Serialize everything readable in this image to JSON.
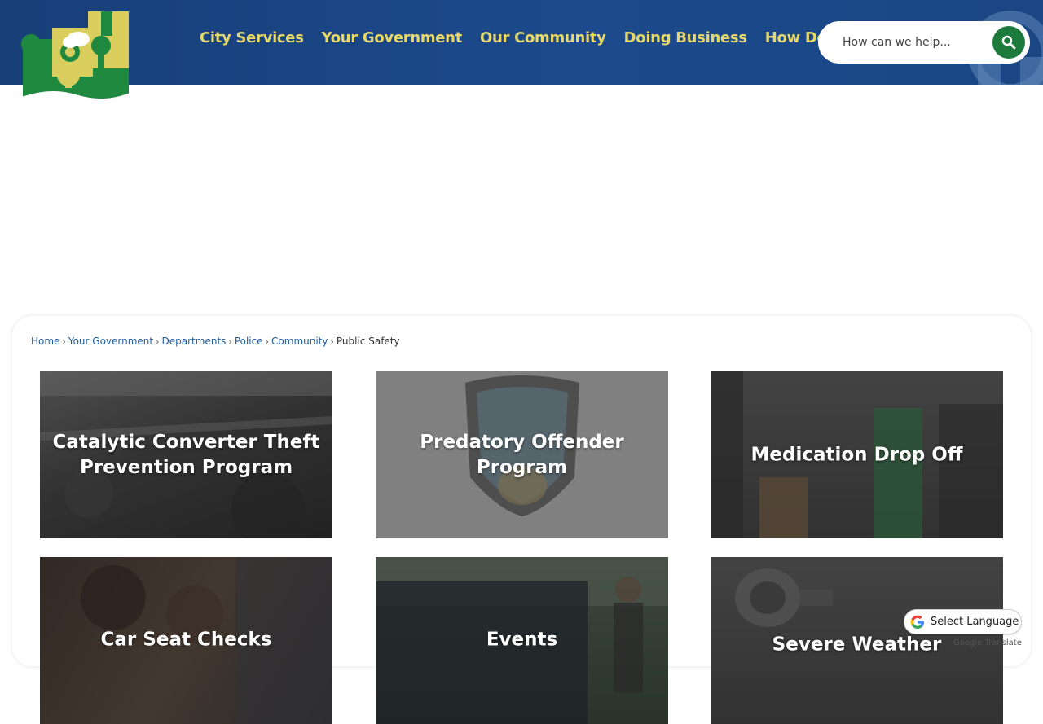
{
  "colors": {
    "header_bg": "#1c4a8c",
    "nav_text": "#e6d76a",
    "search_button": "#1c7a3c",
    "link": "#1f5c9e"
  },
  "header": {
    "logo_icon": "city-logo-icon",
    "nav": [
      "City Services",
      "Your Government",
      "Our Community",
      "Doing Business",
      "How Do I..."
    ],
    "search": {
      "placeholder": "How can we help...",
      "button_icon": "search-icon"
    }
  },
  "breadcrumb": {
    "links": [
      "Home",
      "Your Government",
      "Departments",
      "Police",
      "Community"
    ],
    "separator": "›",
    "current": "Public Safety"
  },
  "tiles": [
    {
      "label": "Catalytic Converter Theft Prevention Program"
    },
    {
      "label": "Predatory Offender Program"
    },
    {
      "label": "Medication Drop Off"
    },
    {
      "label": "Car Seat Checks"
    },
    {
      "label": "Events"
    },
    {
      "label": "Severe Weather"
    }
  ],
  "translate": {
    "label": "Select Language",
    "icon": "google-g-icon",
    "powered_by": "Google Translate"
  }
}
